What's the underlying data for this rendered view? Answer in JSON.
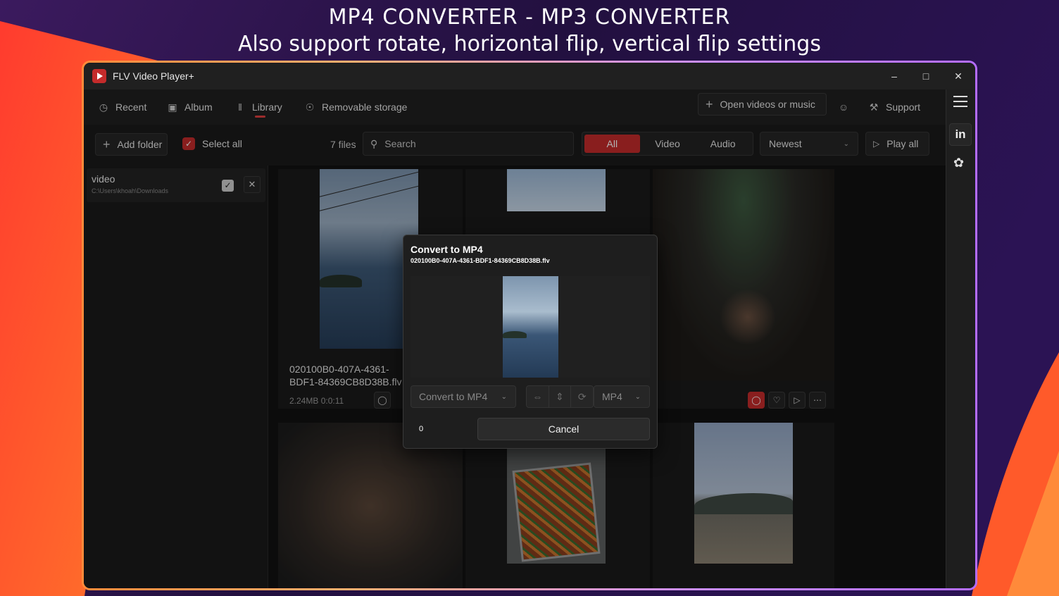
{
  "banner": {
    "line1": "MP4 CONVERTER - MP3 CONVERTER",
    "line2": "Also support rotate, horizontal flip, vertical flip settings"
  },
  "app": {
    "title": "FLV Video Player+",
    "window_controls": [
      "minimize-icon",
      "maximize-icon",
      "close-icon"
    ]
  },
  "nav": {
    "items": [
      {
        "label": "Recent",
        "icon": "clock-icon"
      },
      {
        "label": "Album",
        "icon": "album-icon"
      },
      {
        "label": "Library",
        "icon": "library-icon",
        "active": true
      },
      {
        "label": "Removable storage",
        "icon": "disc-icon"
      }
    ],
    "open_button": "Open videos or music",
    "support_button": "Support"
  },
  "toolbar": {
    "add_folder": "Add folder",
    "select_all": "Select all",
    "file_count": "7 files",
    "search_placeholder": "Search",
    "filters": [
      "All",
      "Video",
      "Audio"
    ],
    "active_filter": "All",
    "sort": "Newest",
    "play_all": "Play all"
  },
  "folders": [
    {
      "name": "video",
      "path": "C:\\Users\\khoah\\Downloads"
    }
  ],
  "cards": [
    {
      "title_line1": "020100B0-407A-4361-",
      "title_line2": "BDF1-84369CB8D38B.flv",
      "meta": "2.24MB  0:0:11"
    }
  ],
  "dialog": {
    "title": "Convert to MP4",
    "file": "020100B0-407A-4361-BDF1-84369CB8D38B.flv",
    "mode": "Convert to MP4",
    "format": "MP4",
    "progress": "0",
    "cancel": "Cancel"
  },
  "colors": {
    "accent": "#c42b2b",
    "window_bg": "#1c1c1c"
  }
}
